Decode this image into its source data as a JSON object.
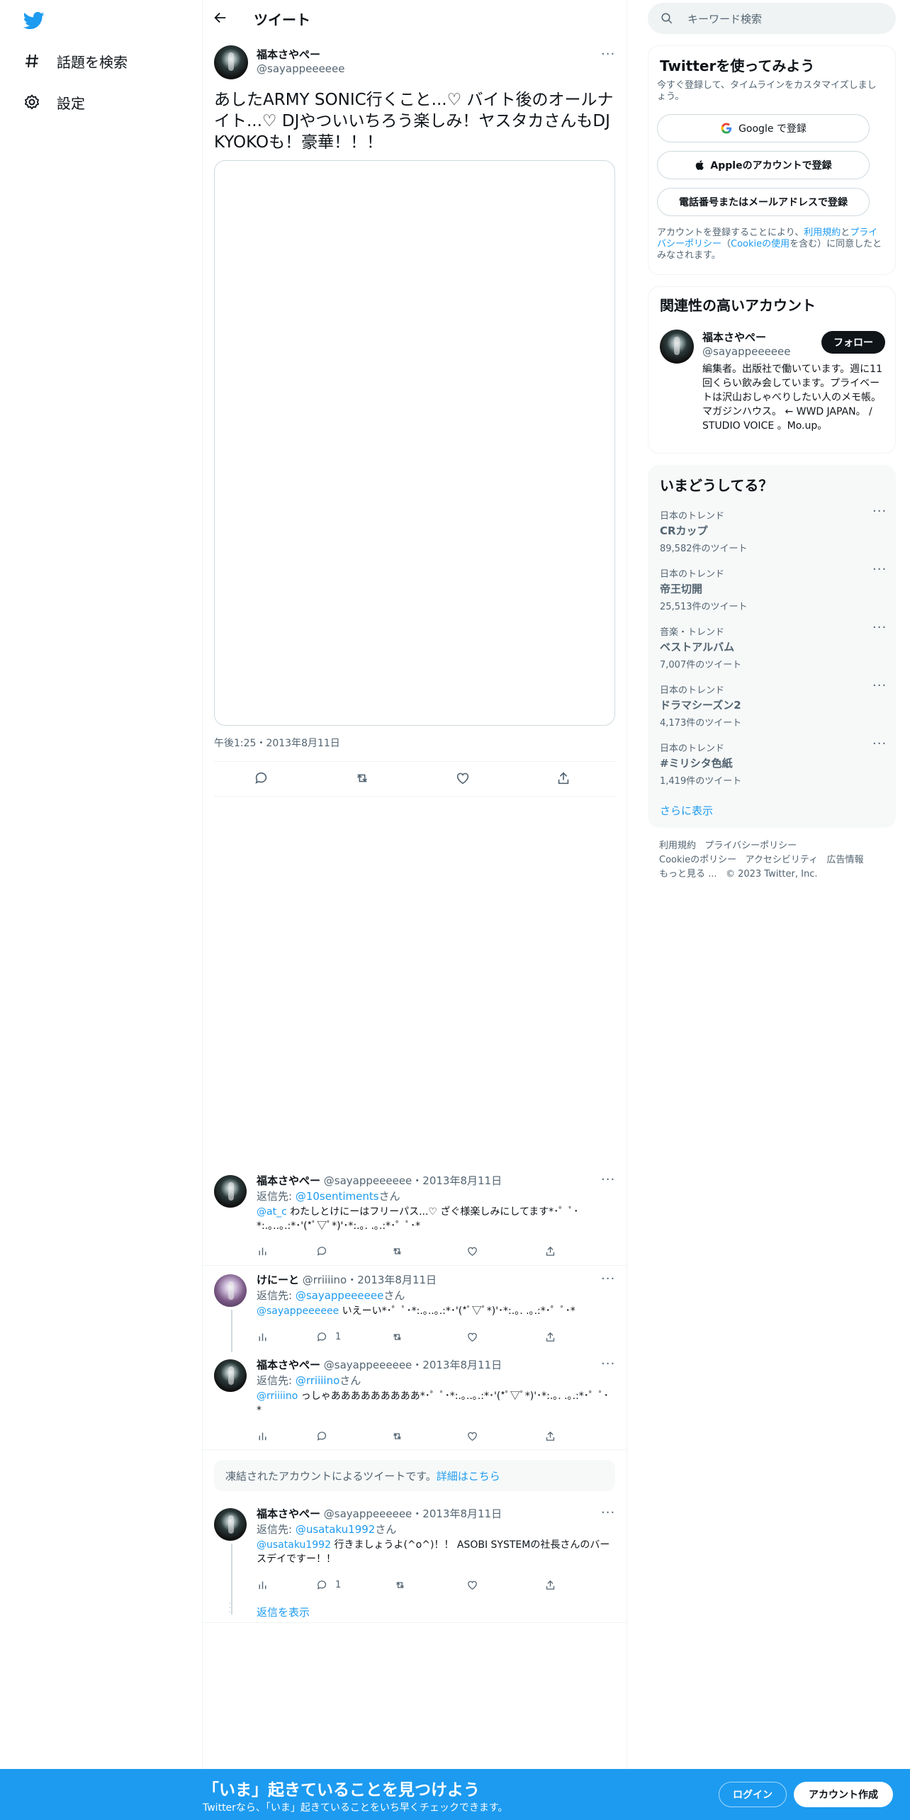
{
  "nav": {
    "explore_label": "話題を検索",
    "settings_label": "設定"
  },
  "header": {
    "title": "ツイート"
  },
  "main_tweet": {
    "name": "福本さやぺー",
    "handle": "@sayappeeeeee",
    "text": "あしたARMY SONIC行くこと...♡ バイト後のオールナイト...♡ DJやついいちろう楽しみ！ヤスタカさんもDJ KYOKOも！豪華！！！",
    "timestamp": "午後1:25・2013年8月11日"
  },
  "replies": [
    {
      "name": "福本さやぺー",
      "handle": "@sayappeeeeee",
      "date": "・2013年8月11日",
      "reply_to_prefix": "返信先: ",
      "reply_to": "@10sentiments",
      "reply_to_suffix": "さん",
      "mention": "@at_c",
      "text": " わたしとけにーはフリーパス...♡ ざぐ様楽しみにしてます*･゜ﾟ･*:.｡..｡.:*･'(*ﾟ▽ﾟ*)'･*:.｡. .｡.:*･゜ﾟ･*",
      "reply_count": ""
    },
    {
      "name": "けにーと",
      "handle": "@rriiiino",
      "date": "・2013年8月11日",
      "reply_to_prefix": "返信先: ",
      "reply_to": "@sayappeeeeee",
      "reply_to_suffix": "さん",
      "mention": "@sayappeeeeee",
      "text": " いえーい*･゜ﾟ･*:.｡..｡.:*･'(*ﾟ▽ﾟ*)'･*:.｡. .｡.:*･゜ﾟ･*",
      "reply_count": "1"
    },
    {
      "name": "福本さやぺー",
      "handle": "@sayappeeeeee",
      "date": "・2013年8月11日",
      "reply_to_prefix": "返信先: ",
      "reply_to": "@rriiiino",
      "reply_to_suffix": "さん",
      "mention": "@rriiiino",
      "text": " っしゃあああああああああ*･゜ﾟ･*:.｡..｡.:*･'(*ﾟ▽ﾟ*)'･*:.｡. .｡.:*･゜ﾟ･*",
      "reply_count": ""
    },
    {
      "name": "福本さやぺー",
      "handle": "@sayappeeeeee",
      "date": "・2013年8月11日",
      "reply_to_prefix": "返信先: ",
      "reply_to": "@usataku1992",
      "reply_to_suffix": "さん",
      "mention": "@usataku1992",
      "text": " 行きましょうよ(^o^)！！ ASOBI SYSTEMの社長さんのバースデイですー！！",
      "reply_count": "1"
    }
  ],
  "suspended_notice": {
    "text": "凍結されたアカウントによるツイートです。",
    "link": "詳細はこちら"
  },
  "show_replies_label": "返信を表示",
  "search": {
    "placeholder": "キーワード検索"
  },
  "signup_card": {
    "title": "Twitterを使ってみよう",
    "subtitle": "今すぐ登録して、タイムラインをカスタマイズしましょう。",
    "google_label": "Google で登録",
    "apple_label": "Appleのアカウントで登録",
    "phone_label": "電話番号またはメールアドレスで登録",
    "legal_prefix": "アカウントを登録することにより、",
    "terms_link": "利用規約",
    "legal_and": "と",
    "privacy_link": "プライバシーポリシー",
    "legal_paren_open": "（",
    "cookie_link": "Cookieの使用",
    "legal_suffix": "を含む）に同意したとみなされます。"
  },
  "relevant_card": {
    "title": "関連性の高いアカウント",
    "name": "福本さやぺー",
    "handle": "@sayappeeeeee",
    "follow_label": "フォロー",
    "bio": "編集者。出版社で働いています。週に11回くらい飲み会しています。プライベートは沢山おしゃべりしたい人のメモ帳。マガジンハウス。 ← WWD JAPAN。 / STUDIO VOICE 。Mo.up。"
  },
  "trends_card": {
    "title": "いまどうしてる？",
    "items": [
      {
        "category": "日本のトレンド",
        "name": "CRカップ",
        "count": "89,582件のツイート"
      },
      {
        "category": "日本のトレンド",
        "name": "帝王切開",
        "count": "25,513件のツイート"
      },
      {
        "category": "音楽・トレンド",
        "name": "ベストアルバム",
        "count": "7,007件のツイート"
      },
      {
        "category": "日本のトレンド",
        "name": "ドラマシーズン2",
        "count": "4,173件のツイート"
      },
      {
        "category": "日本のトレンド",
        "name": "#ミリシタ色紙",
        "count": "1,419件のツイート"
      }
    ],
    "show_more": "さらに表示"
  },
  "footer": {
    "terms": "利用規約",
    "privacy": "プライバシーポリシー",
    "cookie": "Cookieのポリシー",
    "accessibility": "アクセシビリティ",
    "ads": "広告情報",
    "more": "もっと見る ...",
    "copyright": "© 2023 Twitter, Inc."
  },
  "bottom_bar": {
    "headline": "「いま」起きていることを見つけよう",
    "sub": "Twitterなら、「いま」起きていることをいち早くチェックできます。",
    "login": "ログイン",
    "signup": "アカウント作成"
  },
  "colors": {
    "accent": "#1d9bf0",
    "text": "#0f1419",
    "secondary": "#536471"
  }
}
